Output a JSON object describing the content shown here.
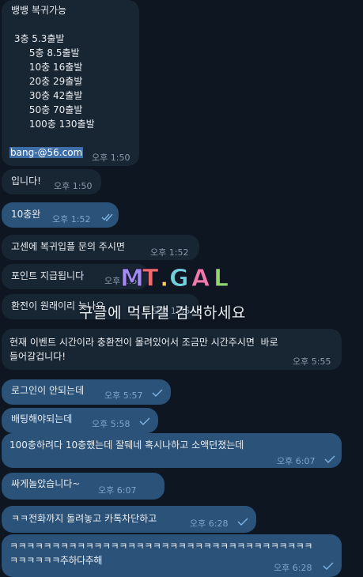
{
  "messages": [
    {
      "text": "뱅뱅 복귀가능\n\n 3충 5.3출발\n      5충 8.5출발\n      10충 16출발\n      20충 29출발\n      30충 42출발\n      50충 70출발\n      100충 130출발",
      "link": "bang-@56.com",
      "time": "오후 1:50"
    },
    {
      "text": "입니다!",
      "time": "오후 1:50"
    },
    {
      "text": "10충완",
      "time": "오후 1:52"
    },
    {
      "text": "고센에 복귀입플 문의 주시면",
      "time": "오후 1:52"
    },
    {
      "text": "포인트 지급됩니다",
      "time": "오후 1:52"
    },
    {
      "text": "환전이 원래이리 늦나요",
      "time": "오후 1:55"
    },
    {
      "text": "현재 이벤트 시간이라 충환전이 몰려있어서 조금만 시간주시면  바로\n들어갈겁니다!",
      "time": "오후 5:55"
    },
    {
      "text": "로그인이 안되는데",
      "time": "오후 5:57"
    },
    {
      "text": "배팅해야되는데",
      "time": "오후 5:58"
    },
    {
      "text": "100충하려다 10충했는데 잘뒈네 혹시나하고 소액던졌는데",
      "time": "오후 6:07"
    },
    {
      "text": "싸게놀았습니다~",
      "time": "오후 6:07"
    },
    {
      "text": "ㅋㅋ전화까지 돌려놓고 카톡차단하고",
      "time": "오후 6:28"
    },
    {
      "text": "ㅋㅋㅋㅋㅋㅋㅋㅋㅋㅋㅋㅋㅋㅋㅋㅋㅋㅋㅋㅋㅋㅋㅋㅋㅋㅋㅋㅋㅋㅋㅋㅋㅋㅋㅋㅋ\nㅋㅋㅋㅋㅋㅋ추하다추해",
      "time": "오후 6:28"
    }
  ],
  "watermark": {
    "logo": "MT.GAL",
    "text": "구글에 먹튀갤 검색하세요"
  },
  "colors": {
    "background": "#0e1621",
    "incoming": "#182533",
    "outgoing": "#2b5278",
    "link_selection": "#3e6fa8"
  },
  "icons": {
    "read_receipt": "double-check-icon",
    "sent_receipt": "single-check-icon"
  }
}
